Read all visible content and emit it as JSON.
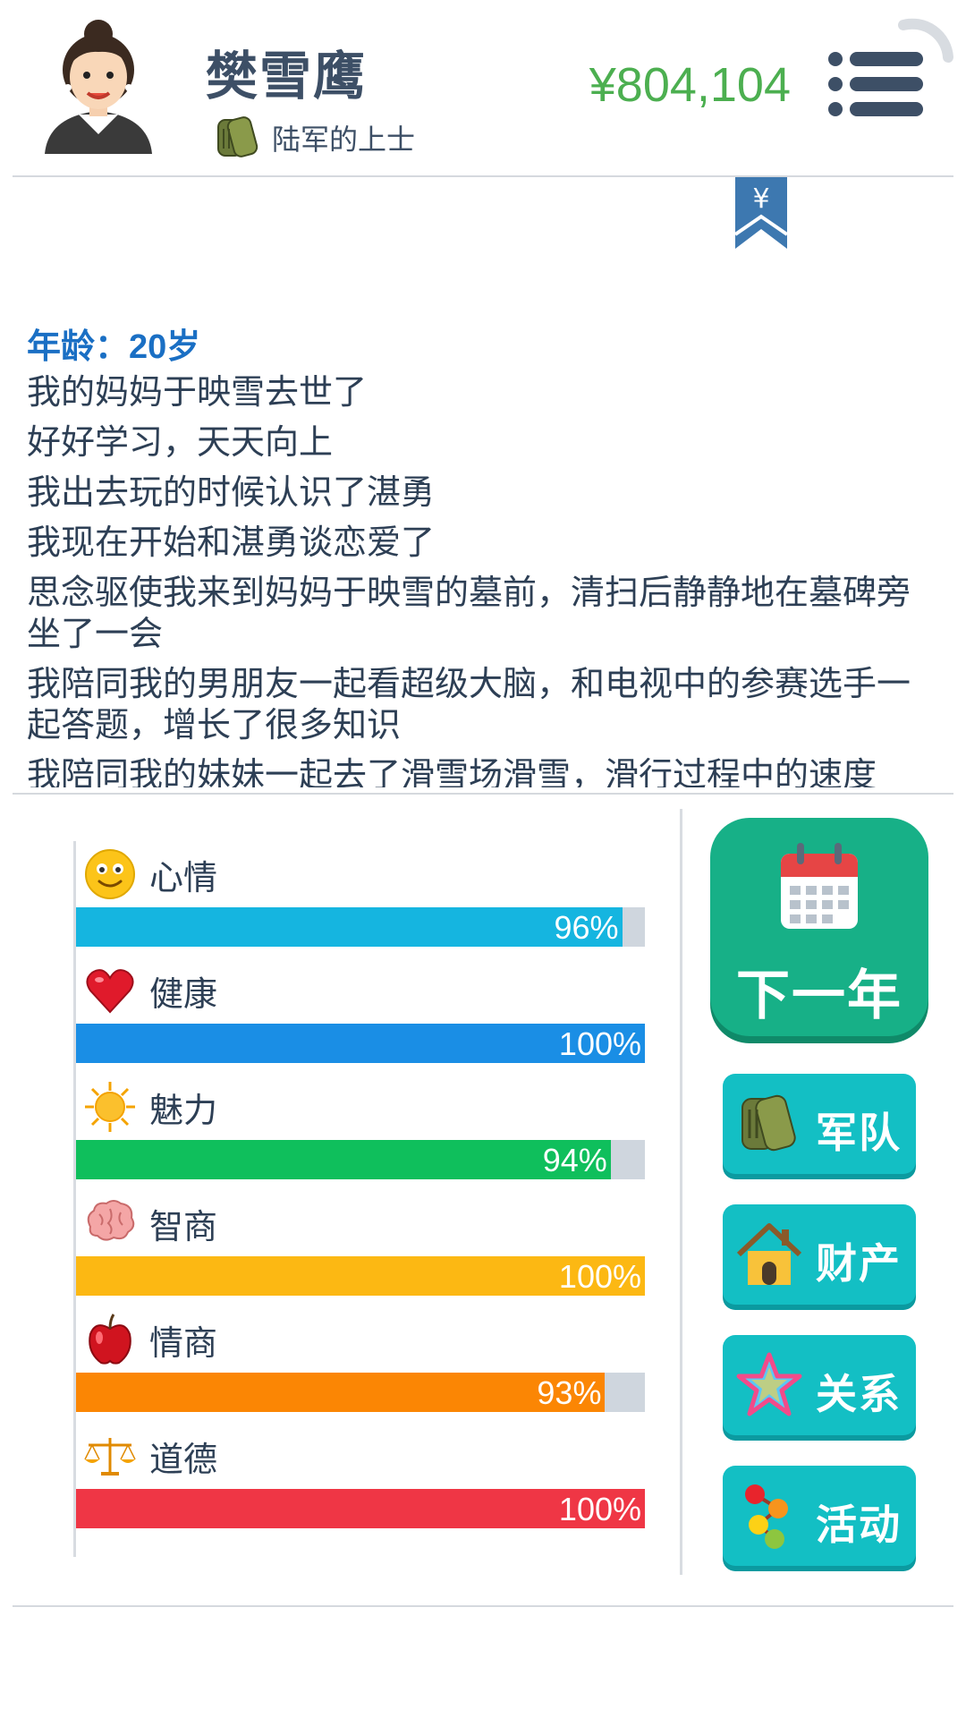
{
  "player": {
    "name": "樊雪鹰",
    "rank": "陆军的上士",
    "money": "¥804,104"
  },
  "log": {
    "age_line": "年龄：20岁",
    "entries": [
      "我的妈妈于映雪去世了",
      "好好学习，天天向上",
      "我出去玩的时候认识了湛勇",
      "我现在开始和湛勇谈恋爱了",
      "思念驱使我来到妈妈于映雪的墓前，清扫后静静地在墓碑旁坐了一会",
      "我陪同我的男朋友一起看超级大脑，和电视中的参赛选手一起答题，增长了很多知识",
      "我陪同我的妹妹一起去了滑雪场滑雪，滑行过程中的速度"
    ]
  },
  "stats": [
    {
      "label": "心情",
      "percent_text": "96%",
      "fraction": 0.96,
      "color": "#15b5e0",
      "icon": "smiley-icon"
    },
    {
      "label": "健康",
      "percent_text": "100%",
      "fraction": 1.0,
      "color": "#1a8ee5",
      "icon": "heart-icon"
    },
    {
      "label": "魅力",
      "percent_text": "94%",
      "fraction": 0.94,
      "color": "#0fbf5c",
      "icon": "sun-icon"
    },
    {
      "label": "智商",
      "percent_text": "100%",
      "fraction": 1.0,
      "color": "#fcb813",
      "icon": "brain-icon"
    },
    {
      "label": "情商",
      "percent_text": "93%",
      "fraction": 0.93,
      "color": "#fb8604",
      "icon": "apple-icon"
    },
    {
      "label": "道德",
      "percent_text": "100%",
      "fraction": 1.0,
      "color": "#ef3645",
      "icon": "scales-icon"
    }
  ],
  "actions": {
    "next_year": "下一年",
    "army": "军队",
    "property": "财产",
    "relations": "关系",
    "activities": "活动"
  },
  "colors": {
    "money": "#4caf50",
    "age_text": "#1a6fc4",
    "next_year_button": "#17b087",
    "side_button": "#13bfc4",
    "bar_track": "#cfd6de"
  }
}
